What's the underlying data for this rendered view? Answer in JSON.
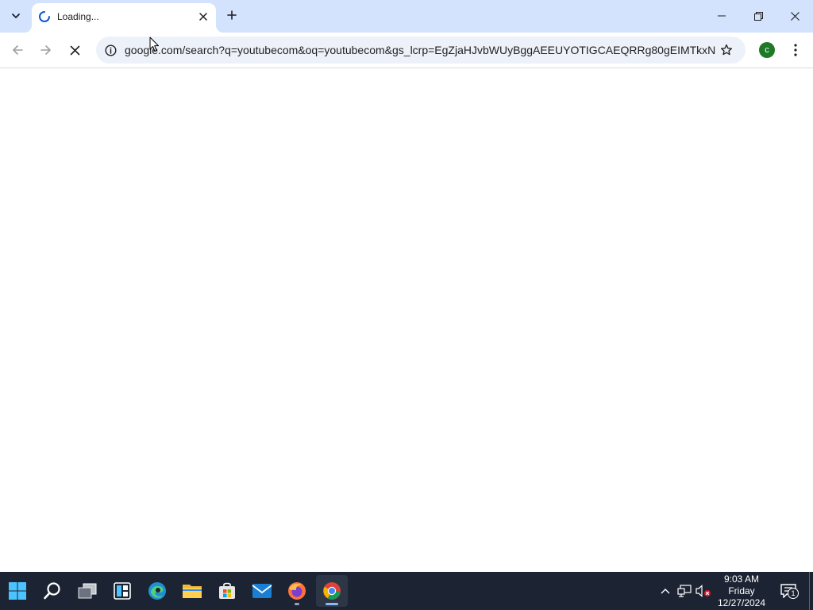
{
  "browser": {
    "tab": {
      "title": "Loading...",
      "state_icon": "loading-spinner-icon"
    },
    "address_bar": {
      "url": "google.com/search?q=youtubecom&oq=youtubecom&gs_lcrp=EgZjaHJvbWUyBggAEEUYOTIGCAEQRRg80gEIMTkxN..."
    },
    "profile": {
      "initial": "c",
      "color": "#1e7a26"
    },
    "colors": {
      "tabstrip": "#d3e3fd",
      "omnibox": "#edf2fa",
      "accent": "#0b57d0"
    }
  },
  "taskbar": {
    "apps": [
      "start",
      "search",
      "task-view",
      "widgets",
      "edge",
      "file-explorer",
      "microsoft-store",
      "mail",
      "firefox",
      "chrome"
    ],
    "clock": {
      "time": "9:03 AM",
      "day": "Friday",
      "date": "12/27/2024"
    },
    "notifications_count": "1"
  }
}
